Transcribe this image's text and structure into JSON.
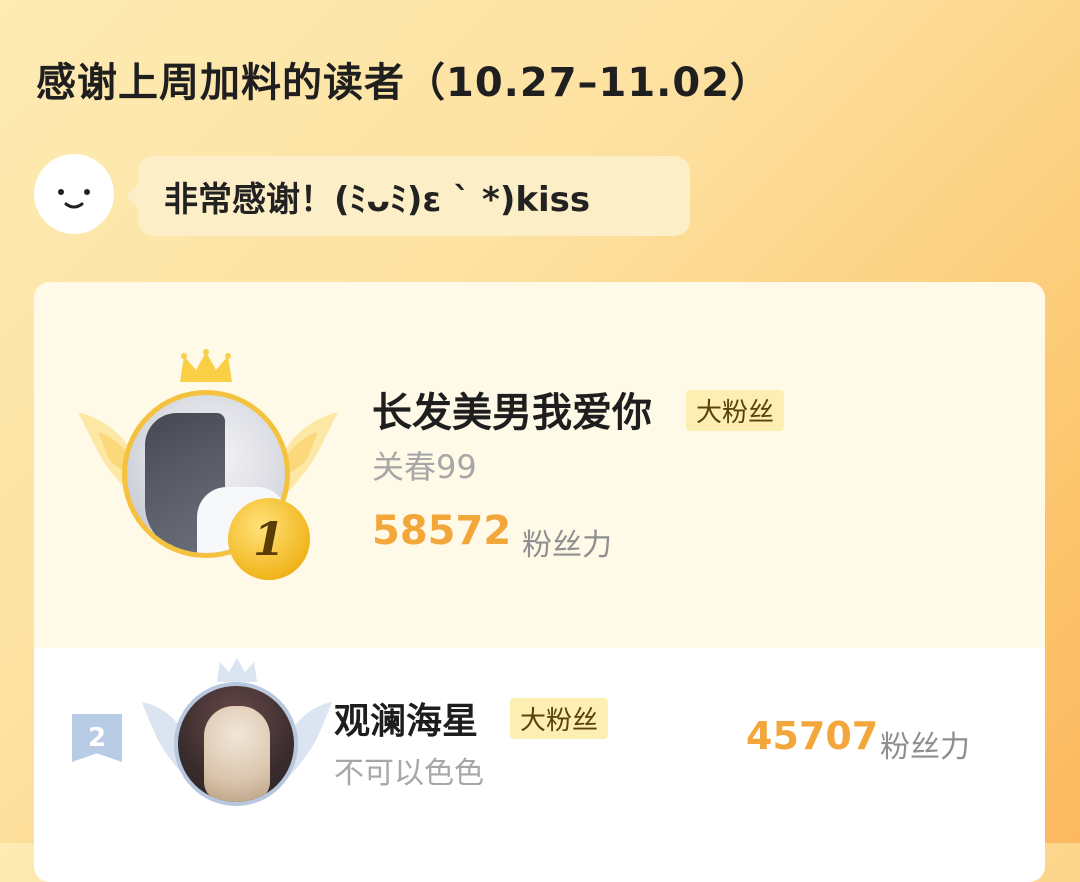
{
  "header": {
    "title": "感谢上周加料的读者（10.27–11.02）"
  },
  "message": {
    "avatar_icon": "smiley-face-icon",
    "text": "非常感谢！(ﾐᴗﾐ)ε ` *)kiss"
  },
  "leaderboard": [
    {
      "rank": "1",
      "name": "长发美男我爱你",
      "badge": "大粉丝",
      "subtitle": "关春99",
      "score": "58572",
      "score_unit": "粉丝力",
      "medal_color": "#f1b61e"
    },
    {
      "rank": "2",
      "name": "观澜海星",
      "badge": "大粉丝",
      "subtitle": "不可以色色",
      "score": "45707",
      "score_unit": "粉丝力",
      "medal_color": "#b8cce6"
    }
  ],
  "colors": {
    "accent_score": "#f3a63a",
    "badge_bg": "#fdeeb1",
    "gold": "#f4c23e",
    "silver": "#b7c7de"
  }
}
